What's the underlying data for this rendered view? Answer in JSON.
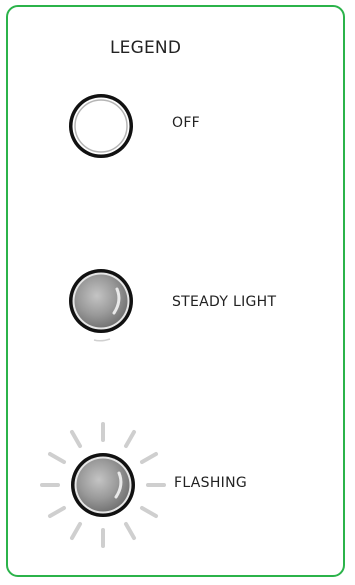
{
  "legend": {
    "title": "LEGEND",
    "items": [
      {
        "state": "off",
        "label": "OFF",
        "icon": "lamp-off-icon"
      },
      {
        "state": "steady",
        "label": "STEADY LIGHT",
        "icon": "lamp-steady-icon"
      },
      {
        "state": "flashing",
        "label": "FLASHING",
        "icon": "lamp-flashing-icon"
      }
    ]
  },
  "colors": {
    "border": "#2bb34a",
    "ring": "#111111",
    "lamp_lit": "#8c8c8c",
    "rays": "#cfcfcf"
  }
}
